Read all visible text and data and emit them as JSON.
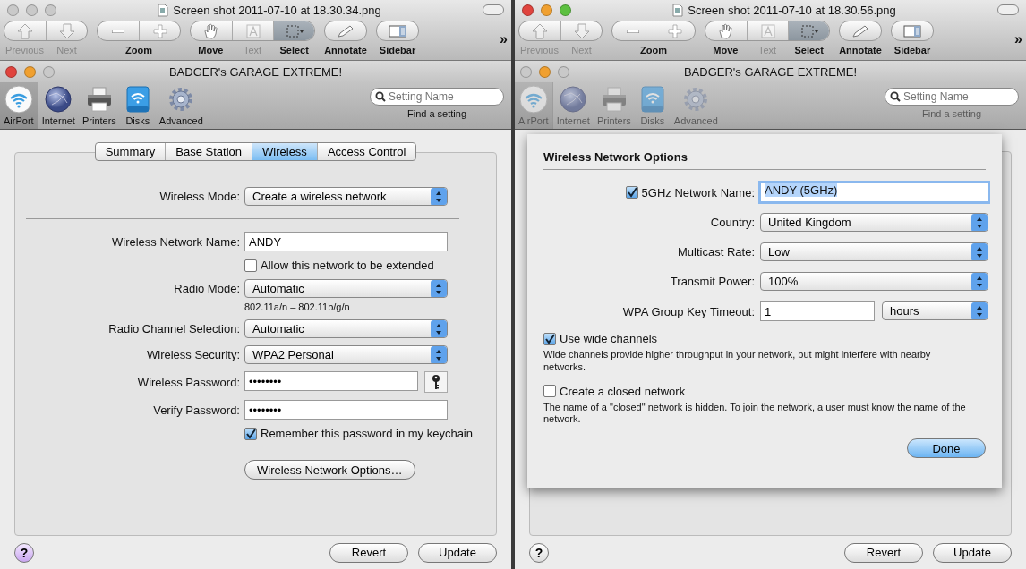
{
  "windows": [
    {
      "title": "Screen shot 2011-07-10 at 18.30.34.png",
      "lights": [
        {
          "color": "#c9c9c9"
        },
        {
          "color": "#c9c9c9"
        },
        {
          "color": "#c9c9c9"
        }
      ],
      "toolbar": [
        {
          "segments": [
            {
              "kind": "previous",
              "label": "Previous",
              "disabled": true,
              "selected": false
            },
            {
              "kind": "next",
              "label": "Next",
              "disabled": true,
              "selected": false
            }
          ]
        },
        {
          "label": "Zoom",
          "segments": [
            {
              "kind": "zoom-out",
              "disabled": false,
              "selected": false
            },
            {
              "kind": "zoom-in",
              "disabled": false,
              "selected": false
            }
          ]
        },
        {
          "segments": [
            {
              "kind": "move",
              "label": "Move",
              "disabled": false,
              "selected": false
            },
            {
              "kind": "text",
              "label": "Text",
              "disabled": true,
              "selected": false
            },
            {
              "kind": "select",
              "label": "Select",
              "disabled": false,
              "selected": true
            }
          ]
        },
        {
          "segments": [
            {
              "kind": "annotate",
              "label": "Annotate",
              "disabled": false,
              "selected": false
            }
          ]
        },
        {
          "segments": [
            {
              "kind": "sidebar",
              "label": "Sidebar",
              "disabled": false,
              "selected": false
            }
          ]
        }
      ],
      "overflow": "»",
      "app": {
        "title": "BADGER's GARAGE EXTREME!",
        "disabled": false,
        "lights": [
          {
            "color": "#e0443e"
          },
          {
            "color": "#f0a030"
          },
          {
            "color": "#c9c9c9"
          }
        ],
        "items": [
          {
            "kind": "airport",
            "label": "AirPort",
            "selected": true
          },
          {
            "kind": "internet",
            "label": "Internet",
            "selected": false
          },
          {
            "kind": "printers",
            "label": "Printers",
            "selected": false
          },
          {
            "kind": "disks",
            "label": "Disks",
            "selected": false
          },
          {
            "kind": "advanced",
            "label": "Advanced",
            "selected": false
          }
        ],
        "search": {
          "placeholder": "Setting Name",
          "caption": "Find a setting"
        },
        "tabs": [
          {
            "label": "Summary",
            "selected": false
          },
          {
            "label": "Base Station",
            "selected": false
          },
          {
            "label": "Wireless",
            "selected": true
          },
          {
            "label": "Access Control",
            "selected": false
          }
        ],
        "form": [
          {
            "kind": "popup",
            "label": "Wireless Mode:",
            "value": "Create a wireless network"
          },
          {
            "kind": "divider"
          },
          {
            "kind": "text",
            "label": "Wireless Network Name:",
            "value": "ANDY"
          },
          {
            "kind": "checkbox",
            "label": "Allow this network to be extended",
            "checked": false
          },
          {
            "kind": "popup",
            "label": "Radio Mode:",
            "value": "Automatic"
          },
          {
            "kind": "note",
            "text": "802.11a/n – 802.11b/g/n"
          },
          {
            "kind": "popup",
            "label": "Radio Channel Selection:",
            "value": "Automatic"
          },
          {
            "kind": "popup",
            "label": "Wireless Security:",
            "value": "WPA2 Personal"
          },
          {
            "kind": "password",
            "label": "Wireless Password:",
            "value": "••••••••",
            "key": true
          },
          {
            "kind": "password",
            "label": "Verify Password:",
            "value": "••••••••",
            "key": false
          },
          {
            "kind": "checkbox",
            "label": "Remember this password in my keychain",
            "checked": true
          },
          {
            "kind": "button",
            "label": "Wireless Network Options…"
          }
        ],
        "help": "?",
        "buttons": [
          "Revert",
          "Update"
        ]
      }
    },
    {
      "title": "Screen shot 2011-07-10 at 18.30.56.png",
      "lights": [
        {
          "color": "#e0443e"
        },
        {
          "color": "#f0a030"
        },
        {
          "color": "#5cc040"
        }
      ],
      "toolbar": [
        {
          "segments": [
            {
              "kind": "previous",
              "label": "Previous",
              "disabled": true,
              "selected": false
            },
            {
              "kind": "next",
              "label": "Next",
              "disabled": true,
              "selected": false
            }
          ]
        },
        {
          "label": "Zoom",
          "segments": [
            {
              "kind": "zoom-out",
              "disabled": false,
              "selected": false
            },
            {
              "kind": "zoom-in",
              "disabled": false,
              "selected": false
            }
          ]
        },
        {
          "segments": [
            {
              "kind": "move",
              "label": "Move",
              "disabled": false,
              "selected": false
            },
            {
              "kind": "text",
              "label": "Text",
              "disabled": true,
              "selected": false
            },
            {
              "kind": "select",
              "label": "Select",
              "disabled": false,
              "selected": true
            }
          ]
        },
        {
          "segments": [
            {
              "kind": "annotate",
              "label": "Annotate",
              "disabled": false,
              "selected": false
            }
          ]
        },
        {
          "segments": [
            {
              "kind": "sidebar",
              "label": "Sidebar",
              "disabled": false,
              "selected": false
            }
          ]
        }
      ],
      "overflow": "»",
      "app": {
        "title": "BADGER's GARAGE EXTREME!",
        "disabled": true,
        "lights": [
          {
            "color": "#c9c9c9"
          },
          {
            "color": "#f0a030"
          },
          {
            "color": "#c9c9c9"
          }
        ],
        "items": [
          {
            "kind": "airport",
            "label": "AirPort",
            "selected": true
          },
          {
            "kind": "internet",
            "label": "Internet",
            "selected": false
          },
          {
            "kind": "printers",
            "label": "Printers",
            "selected": false
          },
          {
            "kind": "disks",
            "label": "Disks",
            "selected": false
          },
          {
            "kind": "advanced",
            "label": "Advanced",
            "selected": false
          }
        ],
        "search": {
          "placeholder": "Setting Name",
          "caption": "Find a setting"
        },
        "sheet": {
          "title": "Wireless Network Options",
          "rows": [
            {
              "kind": "check-field",
              "label": "5GHz Network Name:",
              "checked": true,
              "value": "ANDY (5GHz)"
            },
            {
              "kind": "popup",
              "label": "Country:",
              "value": "United Kingdom"
            },
            {
              "kind": "popup",
              "label": "Multicast Rate:",
              "value": "Low"
            },
            {
              "kind": "popup",
              "label": "Transmit Power:",
              "value": "100%"
            },
            {
              "kind": "field-popup",
              "label": "WPA Group Key Timeout:",
              "value": "1",
              "unit": "hours"
            },
            {
              "kind": "checkbox",
              "label": "Use wide channels",
              "checked": true
            },
            {
              "kind": "note",
              "text": "Wide channels provide higher throughput in your network, but might interfere with nearby networks."
            },
            {
              "kind": "checkbox",
              "label": "Create a closed network",
              "checked": false
            },
            {
              "kind": "note",
              "text": "The name of a \"closed\" network is hidden. To join the network, a user must know the name of the network."
            }
          ],
          "button": "Done"
        },
        "help": "?",
        "buttons": [
          "Revert",
          "Update"
        ]
      }
    }
  ]
}
